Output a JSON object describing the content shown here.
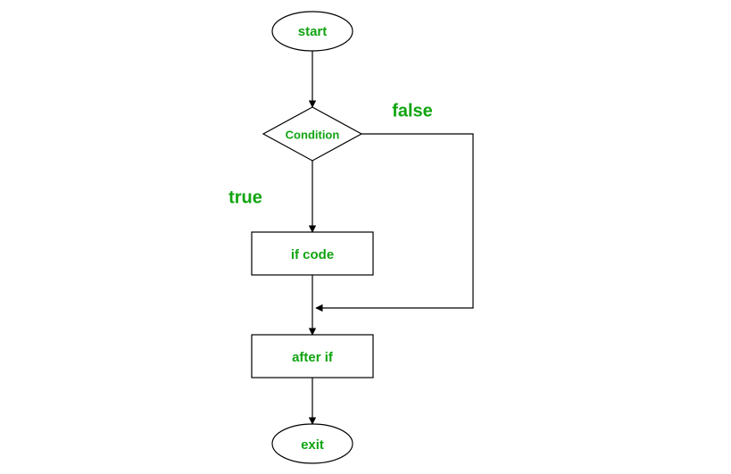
{
  "flowchart": {
    "nodes": {
      "start": {
        "label": "start",
        "shape": "ellipse"
      },
      "condition": {
        "label": "Condition",
        "shape": "diamond"
      },
      "if_code": {
        "label": "if code",
        "shape": "rect"
      },
      "after_if": {
        "label": "after if",
        "shape": "rect"
      },
      "exit": {
        "label": "exit",
        "shape": "ellipse"
      }
    },
    "edges": {
      "true_label": "true",
      "false_label": "false"
    },
    "colors": {
      "text": "#11a411",
      "stroke": "#000000",
      "bg": "#ffffff"
    }
  }
}
